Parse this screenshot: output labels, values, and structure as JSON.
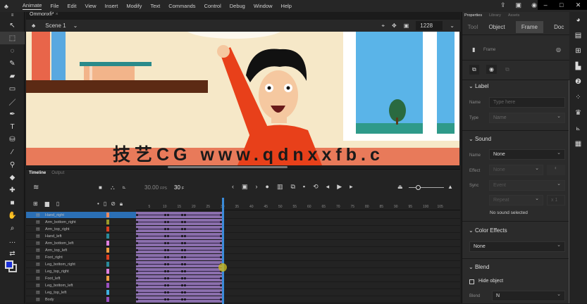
{
  "menu": {
    "app": "Animate",
    "items": [
      "File",
      "Edit",
      "View",
      "Insert",
      "Modify",
      "Text",
      "Commands",
      "Control",
      "Debug",
      "Window",
      "Help"
    ]
  },
  "document": {
    "tab": "Ommonxfi*",
    "scene": "Scene 1",
    "zoom": "1228"
  },
  "watermark": "技艺CG  www.qdnxxfb.c",
  "timeline": {
    "tabs": [
      "Timeline",
      "Output"
    ],
    "fps": "30.00",
    "fps_unit": "FPS",
    "frame": "30",
    "frame_unit": "F",
    "ruler": [
      "5",
      "10",
      "15",
      "20",
      "25",
      "30",
      "35",
      "40",
      "45",
      "50",
      "55",
      "60",
      "65",
      "70",
      "75",
      "80",
      "85",
      "90",
      "95",
      "100",
      "105"
    ],
    "playhead_frame": 30,
    "layers": [
      {
        "name": "Hand_right",
        "color": "#f08a5d"
      },
      {
        "name": "Arm_bottom_right",
        "color": "#9a9a2a"
      },
      {
        "name": "Arm_top_right",
        "color": "#e04020"
      },
      {
        "name": "Hand_left",
        "color": "#2a8a9a"
      },
      {
        "name": "Arm_bottom_left",
        "color": "#e080e0"
      },
      {
        "name": "Arm_top_left",
        "color": "#f0a040"
      },
      {
        "name": "Foot_right",
        "color": "#e04020"
      },
      {
        "name": "Leg_bottom_right",
        "color": "#2a8a9a"
      },
      {
        "name": "Leg_top_right",
        "color": "#e080e0"
      },
      {
        "name": "Foot_left",
        "color": "#f0a040"
      },
      {
        "name": "Leg_bottom_left",
        "color": "#9a50c0"
      },
      {
        "name": "Leg_top_left",
        "color": "#40b0e0"
      },
      {
        "name": "Body",
        "color": "#9a50c0"
      }
    ]
  },
  "properties": {
    "tabs": [
      "Properties",
      "Library",
      "Assets"
    ],
    "subtabs": [
      "Tool",
      "Object",
      "Frame",
      "Doc"
    ],
    "active_subtab": "Frame",
    "frame_label": "Frame",
    "label": {
      "title": "Label",
      "name_label": "Name",
      "name_placeholder": "Type here",
      "type_label": "Type",
      "type_value": "Name"
    },
    "sound": {
      "title": "Sound",
      "name_label": "Name",
      "name_value": "None",
      "effect_label": "Effect",
      "effect_value": "None",
      "sync_label": "Sync",
      "sync_value": "Event",
      "repeat_value": "Repeat",
      "repeat_count": "x 1",
      "status": "No sound selected"
    },
    "color_effects": {
      "title": "Color Effects",
      "value": "None"
    },
    "blend": {
      "title": "Blend",
      "hide_object": "Hide object",
      "blend_label": "Blend",
      "blend_value": "N"
    }
  }
}
